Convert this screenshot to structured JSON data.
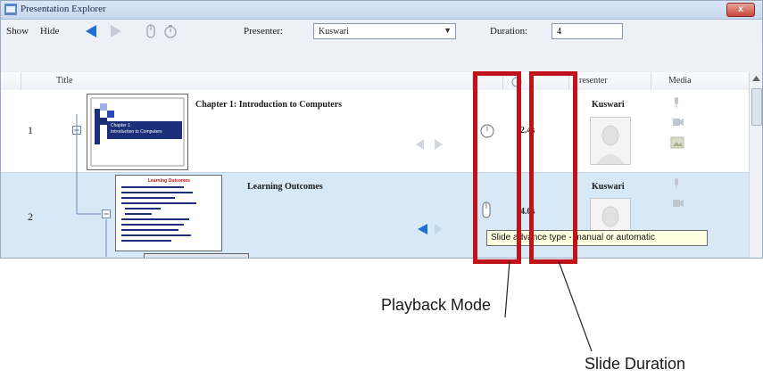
{
  "window": {
    "title": "Presentation Explorer",
    "close_label": "x"
  },
  "toolbar": {
    "show_label": "Show",
    "hide_label": "Hide",
    "presenter_label": "Presenter:",
    "presenter_value": "Kuswari",
    "duration_label": "Duration:",
    "duration_value": "4"
  },
  "table": {
    "headers": {
      "title": "Title",
      "presenter": "resenter",
      "media": "Media"
    },
    "rows": [
      {
        "num": "1",
        "title": "Chapter 1: Introduction to Computers",
        "presenter": "Kuswari",
        "duration": "2.4s"
      },
      {
        "num": "2",
        "title": "Learning Outcomes",
        "presenter": "Kuswari",
        "duration": "4.0s"
      }
    ],
    "slide1_thumb": {
      "line1": "Chapter 1",
      "line2": "Introduction to Computers"
    },
    "slide2_thumb": {
      "heading": "Learning Outcomes"
    }
  },
  "tooltip": "Slide advance type - manual or automatic",
  "annotations": {
    "playback_mode": "Playback Mode",
    "slide_duration": "Slide Duration"
  },
  "colors": {
    "highlight": "#c0121b",
    "selected_row": "#d7e8f6",
    "nav_arrow": "#1f6fd1"
  }
}
